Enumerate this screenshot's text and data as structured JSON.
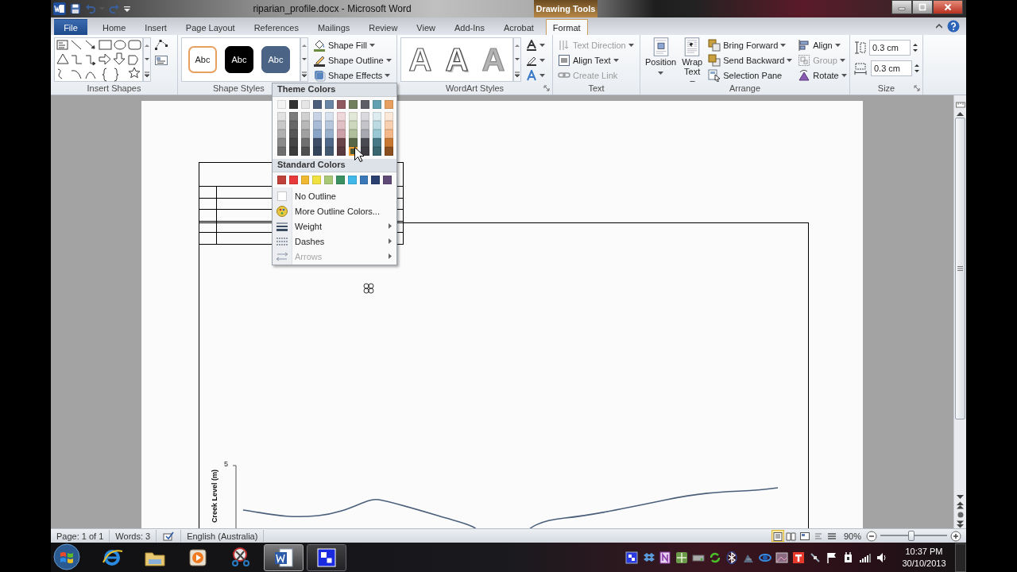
{
  "window": {
    "title": "riparian_profile.docx - Microsoft Word",
    "tool_group": "Drawing Tools"
  },
  "tabs": [
    {
      "label": "File",
      "kind": "file",
      "selected": false
    },
    {
      "label": "Home",
      "kind": "tab",
      "selected": false
    },
    {
      "label": "Insert",
      "kind": "tab",
      "selected": false
    },
    {
      "label": "Page Layout",
      "kind": "tab",
      "selected": false
    },
    {
      "label": "References",
      "kind": "tab",
      "selected": false
    },
    {
      "label": "Mailings",
      "kind": "tab",
      "selected": false
    },
    {
      "label": "Review",
      "kind": "tab",
      "selected": false
    },
    {
      "label": "View",
      "kind": "tab",
      "selected": false
    },
    {
      "label": "Add-Ins",
      "kind": "tab",
      "selected": false
    },
    {
      "label": "Acrobat",
      "kind": "tab",
      "selected": false
    },
    {
      "label": "Format",
      "kind": "contextual",
      "selected": true
    }
  ],
  "ribbon": {
    "insert_shapes": {
      "label": "Insert Shapes"
    },
    "shape_styles": {
      "label": "Shape Styles",
      "presets": [
        {
          "text": "Abc",
          "kind": "outline",
          "color": "#e8a060"
        },
        {
          "text": "Abc",
          "kind": "filled",
          "color": "#000000"
        },
        {
          "text": "Abc",
          "kind": "filled",
          "color": "#4b6385"
        }
      ],
      "commands": [
        {
          "label": "Shape Fill",
          "dropdown": true
        },
        {
          "label": "Shape Outline",
          "dropdown": true
        },
        {
          "label": "Shape Effects",
          "dropdown": true
        }
      ]
    },
    "wordart_styles": {
      "label": "WordArt Styles",
      "presets": [
        {
          "text": "A",
          "kind": "outline"
        },
        {
          "text": "A",
          "kind": "shadow"
        },
        {
          "text": "A",
          "kind": "faded"
        }
      ]
    },
    "text": {
      "label": "Text",
      "commands": [
        {
          "label": "Text Direction",
          "dropdown": true,
          "disabled": true
        },
        {
          "label": "Align Text",
          "dropdown": true,
          "disabled": false
        },
        {
          "label": "Create Link",
          "dropdown": false,
          "disabled": true
        }
      ]
    },
    "arrange": {
      "label": "Arrange",
      "large_commands": [
        {
          "label": "Position",
          "dropdown": true
        },
        {
          "label": "Wrap Text",
          "dropdown": true
        }
      ],
      "commands": [
        {
          "label": "Bring Forward",
          "dropdown": true,
          "disabled": false
        },
        {
          "label": "Send Backward",
          "dropdown": true,
          "disabled": false
        },
        {
          "label": "Selection Pane",
          "dropdown": false,
          "disabled": false
        },
        {
          "label": "Align",
          "dropdown": true,
          "disabled": false
        },
        {
          "label": "Group",
          "dropdown": true,
          "disabled": true
        },
        {
          "label": "Rotate",
          "dropdown": true,
          "disabled": false
        }
      ]
    },
    "size": {
      "label": "Size",
      "fields": [
        {
          "value": "0.3 cm"
        },
        {
          "value": "0.3 cm"
        }
      ]
    }
  },
  "outline_menu": {
    "theme_heading": "Theme Colors",
    "theme_colors": [
      {
        "color": "#f4f4f4",
        "shades": [
          {
            "color": "#e2e2e2",
            "hovered": false
          },
          {
            "color": "#c8c8c8",
            "hovered": false
          },
          {
            "color": "#b0b0b0",
            "hovered": false
          },
          {
            "color": "#8a8a8a",
            "hovered": false
          },
          {
            "color": "#6e6e6e",
            "hovered": false
          }
        ]
      },
      {
        "color": "#333333",
        "shades": [
          {
            "color": "#7a7a7a",
            "hovered": false
          },
          {
            "color": "#666666",
            "hovered": false
          },
          {
            "color": "#555555",
            "hovered": false
          },
          {
            "color": "#444444",
            "hovered": false
          },
          {
            "color": "#3a3a3a",
            "hovered": false
          }
        ]
      },
      {
        "color": "#e6e6e6",
        "shades": [
          {
            "color": "#d0d0d0",
            "hovered": false
          },
          {
            "color": "#b8b8b8",
            "hovered": false
          },
          {
            "color": "#a0a0a0",
            "hovered": false
          },
          {
            "color": "#707070",
            "hovered": false
          },
          {
            "color": "#505050",
            "hovered": false
          }
        ]
      },
      {
        "color": "#4b5d7a",
        "shades": [
          {
            "color": "#c8d4e6",
            "hovered": false
          },
          {
            "color": "#a8bcd8",
            "hovered": false
          },
          {
            "color": "#8aa4c8",
            "hovered": false
          },
          {
            "color": "#3e4e68",
            "hovered": false
          },
          {
            "color": "#34445a",
            "hovered": false
          }
        ]
      },
      {
        "color": "#6a86a6",
        "shades": [
          {
            "color": "#d8e2ee",
            "hovered": false
          },
          {
            "color": "#b8c8dc",
            "hovered": false
          },
          {
            "color": "#98b0cc",
            "hovered": false
          },
          {
            "color": "#50688a",
            "hovered": false
          },
          {
            "color": "#42586f",
            "hovered": false
          }
        ]
      },
      {
        "color": "#8e5a60",
        "shades": [
          {
            "color": "#eed8da",
            "hovered": false
          },
          {
            "color": "#e0c0c4",
            "hovered": false
          },
          {
            "color": "#cca0a6",
            "hovered": false
          },
          {
            "color": "#6a4448",
            "hovered": false
          },
          {
            "color": "#583a3e",
            "hovered": false
          }
        ]
      },
      {
        "color": "#72805e",
        "shades": [
          {
            "color": "#e2e8d8",
            "hovered": false
          },
          {
            "color": "#ccd8bc",
            "hovered": false
          },
          {
            "color": "#b0c09c",
            "hovered": false
          },
          {
            "color": "#586648",
            "hovered": false
          },
          {
            "color": "#4a5638",
            "hovered": true
          }
        ]
      },
      {
        "color": "#5e5e66",
        "shades": [
          {
            "color": "#dadade",
            "hovered": false
          },
          {
            "color": "#c4c4ca",
            "hovered": false
          },
          {
            "color": "#a8a8b0",
            "hovered": false
          },
          {
            "color": "#4a4a52",
            "hovered": false
          },
          {
            "color": "#3e3e44",
            "hovered": false
          }
        ]
      },
      {
        "color": "#60a0b0",
        "shades": [
          {
            "color": "#dcecf0",
            "hovered": false
          },
          {
            "color": "#bcdae2",
            "hovered": false
          },
          {
            "color": "#98c8d4",
            "hovered": false
          },
          {
            "color": "#467886",
            "hovered": false
          },
          {
            "color": "#3a6670",
            "hovered": false
          }
        ]
      },
      {
        "color": "#e8a060",
        "shades": [
          {
            "color": "#fce8d8",
            "hovered": false
          },
          {
            "color": "#f8d0b0",
            "hovered": false
          },
          {
            "color": "#f4b888",
            "hovered": false
          },
          {
            "color": "#c87830",
            "hovered": false
          },
          {
            "color": "#8a5020",
            "hovered": false
          }
        ]
      }
    ],
    "standard_heading": "Standard Colors",
    "standard_colors": [
      {
        "color": "#c0403a"
      },
      {
        "color": "#e83a3a"
      },
      {
        "color": "#f0b830"
      },
      {
        "color": "#f0e040"
      },
      {
        "color": "#a8c878"
      },
      {
        "color": "#3a9060"
      },
      {
        "color": "#40b8e8"
      },
      {
        "color": "#3a78b8"
      },
      {
        "color": "#2a4070"
      },
      {
        "color": "#604a78"
      }
    ],
    "items": [
      {
        "label": "No Outline",
        "kind": "none",
        "submenu": false,
        "disabled": false
      },
      {
        "label": "More Outline Colors...",
        "kind": "palette",
        "submenu": false,
        "disabled": false
      },
      {
        "label": "Weight",
        "kind": "weight",
        "submenu": true,
        "disabled": false
      },
      {
        "label": "Dashes",
        "kind": "dashes",
        "submenu": true,
        "disabled": false
      },
      {
        "label": "Arrows",
        "kind": "arrows",
        "submenu": true,
        "disabled": true
      }
    ]
  },
  "document": {
    "chart": {
      "y_axis_title": "Creek Level (m)",
      "y_tick": "5"
    }
  },
  "status_bar": {
    "page": "Page: 1 of 1",
    "words": "Words: 3",
    "language": "English (Australia)",
    "views": [
      {
        "selected": true
      },
      {
        "selected": false
      },
      {
        "selected": false
      },
      {
        "selected": false
      },
      {
        "selected": false
      }
    ],
    "zoom": {
      "reading": "90%",
      "level": 0.47
    }
  },
  "taskbar": {
    "apps": [
      {
        "running": false,
        "active": false
      },
      {
        "running": false,
        "active": false
      },
      {
        "running": false,
        "active": false
      },
      {
        "running": false,
        "active": false
      },
      {
        "running": true,
        "active": true
      },
      {
        "running": true,
        "active": false
      }
    ],
    "clock": {
      "time": "10:37 PM",
      "date": "30/10/2013"
    }
  }
}
